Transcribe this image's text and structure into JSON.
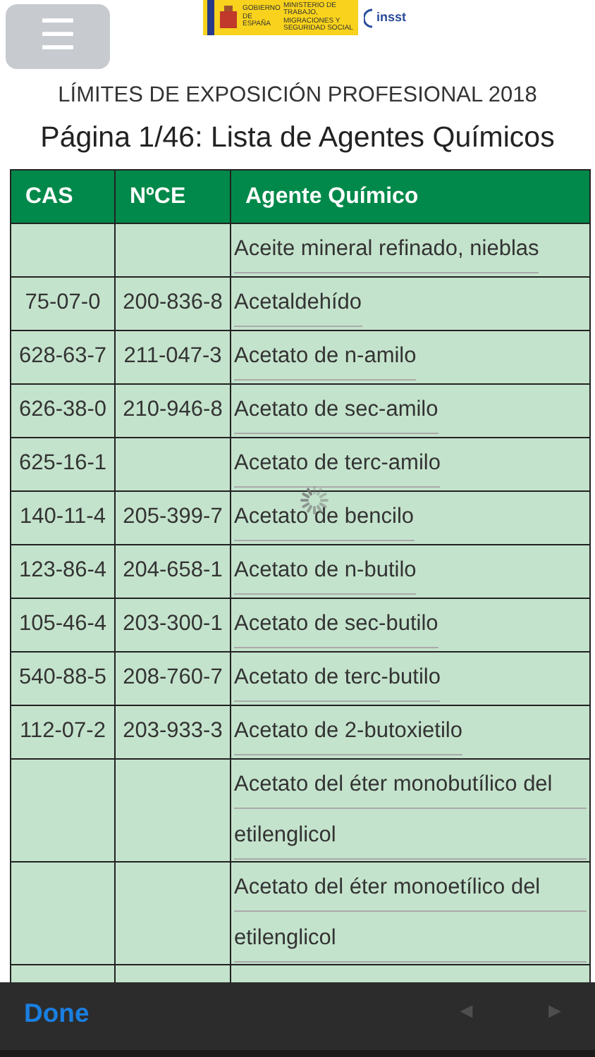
{
  "header": {
    "menu_button": "☰",
    "logo_government": {
      "line_1": "GOBIERNO DE ESPAÑA",
      "line_2": "MINISTERIO DE TRABAJO, MIGRACIONES Y SEGURIDAD SOCIAL"
    },
    "logo_insst": "insst"
  },
  "title": "LÍMITES DE EXPOSICIÓN PROFESIONAL 2018",
  "subtitle": "Página 1/46: Lista de Agentes Químicos",
  "table": {
    "columns": [
      "CAS",
      "NºCE",
      "Agente Químico"
    ],
    "rows": [
      {
        "cas": "",
        "ce": "",
        "agent": "Aceite mineral refinado, nieblas"
      },
      {
        "cas": "75-07-0",
        "ce": "200-836-8",
        "agent": "Acetaldehído"
      },
      {
        "cas": "628-63-7",
        "ce": "211-047-3",
        "agent": "Acetato de n-amilo"
      },
      {
        "cas": "626-38-0",
        "ce": "210-946-8",
        "agent": "Acetato de sec-amilo"
      },
      {
        "cas": "625-16-1",
        "ce": "",
        "agent": "Acetato de terc-amilo"
      },
      {
        "cas": "140-11-4",
        "ce": "205-399-7",
        "agent": "Acetato de bencilo"
      },
      {
        "cas": "123-86-4",
        "ce": "204-658-1",
        "agent": "Acetato de n-butilo"
      },
      {
        "cas": "105-46-4",
        "ce": "203-300-1",
        "agent": "Acetato de sec-butilo"
      },
      {
        "cas": "540-88-5",
        "ce": "208-760-7",
        "agent": "Acetato de terc-butilo"
      },
      {
        "cas": "112-07-2",
        "ce": "203-933-3",
        "agent": "Acetato de 2-butoxietilo"
      },
      {
        "cas": "",
        "ce": "",
        "agent": "Acetato del éter monobutílico del etilenglicol"
      },
      {
        "cas": "",
        "ce": "",
        "agent": "Acetato del éter monoetílico del etilenglicol"
      }
    ]
  },
  "loading": true,
  "toolbar": {
    "done": "Done",
    "previous": {
      "label": "◄",
      "disabled": true
    },
    "next": {
      "label": "►",
      "disabled": true
    }
  }
}
